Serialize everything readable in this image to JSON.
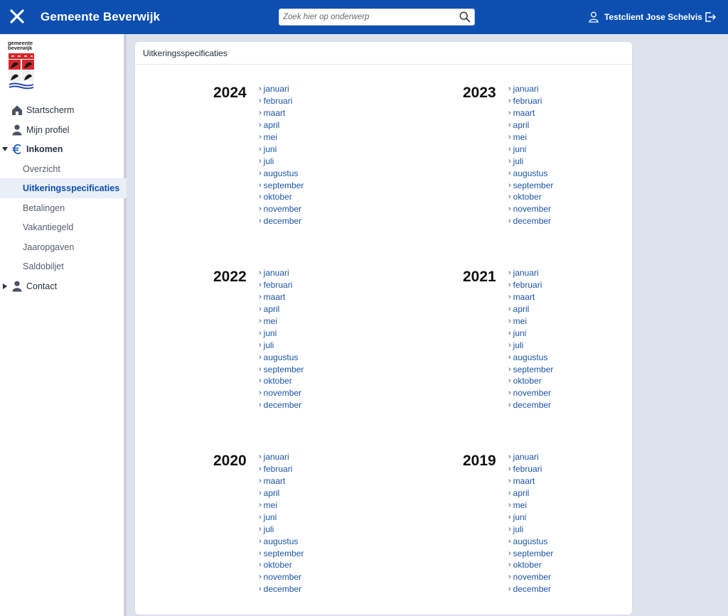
{
  "header": {
    "title": "Gemeente Beverwijk",
    "search_placeholder": "Zoek hier op onderwerp",
    "user_name": "Testclient Jose Schelvis"
  },
  "logo": {
    "line1": "gemeente",
    "line2": "beverwijk"
  },
  "sidebar": {
    "items": [
      {
        "label": "Startscherm",
        "icon": "home-icon"
      },
      {
        "label": "Mijn profiel",
        "icon": "person-icon"
      },
      {
        "label": "Inkomen",
        "icon": "euro-icon",
        "expanded": true,
        "children": [
          {
            "label": "Overzicht"
          },
          {
            "label": "Uitkeringsspecificaties",
            "active": true
          },
          {
            "label": "Betalingen"
          },
          {
            "label": "Vakantiegeld"
          },
          {
            "label": "Jaaropgaven"
          },
          {
            "label": "Saldobiljet"
          }
        ]
      },
      {
        "label": "Contact",
        "icon": "person-icon",
        "expanded": false
      }
    ]
  },
  "main": {
    "card_title": "Uitkeringsspecificaties",
    "years": [
      "2024",
      "2023",
      "2022",
      "2021",
      "2020",
      "2019"
    ],
    "months": [
      "januari",
      "februari",
      "maart",
      "april",
      "mei",
      "juni",
      "juli",
      "augustus",
      "september",
      "oktober",
      "november",
      "december"
    ]
  },
  "colors": {
    "topbar": "#0d4fb0",
    "link": "#1b55a6",
    "active_bg": "#e9eef7"
  }
}
